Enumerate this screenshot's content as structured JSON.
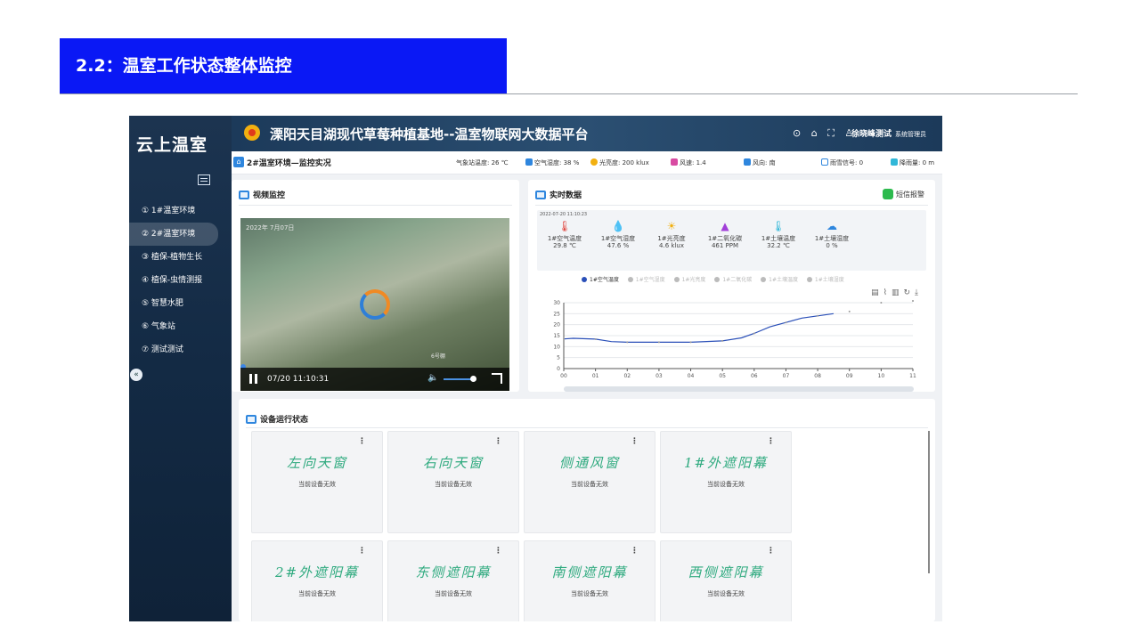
{
  "slide": {
    "title": "2.2：温室工作状态整体监控"
  },
  "app": {
    "logo": "云上温室",
    "header": {
      "title": "溧阳天目湖现代草莓种植基地--温室物联网大数据平台",
      "icons_text": "⊙ ⌂ ⛶ ♙",
      "user": "徐晓峰测试",
      "role": "系统管理员"
    },
    "nav": [
      {
        "label": "① 1#温室环境"
      },
      {
        "label": "② 2#温室环境"
      },
      {
        "label": "③ 植保-植物生长"
      },
      {
        "label": "④ 植保-虫情测报"
      },
      {
        "label": "⑤ 智慧水肥"
      },
      {
        "label": "⑥ 气象站"
      },
      {
        "label": "⑦ 测试测试"
      }
    ],
    "weather_bar": {
      "title": "2#温室环境—监控实况",
      "station": "气象站温度: 26 ℃",
      "air_humidity": "空气湿度: 38 %",
      "light": "光亮度: 200 klux",
      "wind_speed": "风速: 1.4",
      "wind_dir": "风向: 南",
      "rain_signal": "雨雪信号: 0",
      "rainfall": "降雨量: 0 m"
    },
    "video_panel": {
      "title": "视频监控",
      "timestamp": "2022年 7月07日",
      "camera": "6号棚",
      "time": "07/20 11:10:31"
    },
    "realtime_panel": {
      "title": "实时数据",
      "sms_label": "短信报警",
      "date": "2022-07-20 11:10:23",
      "sensors": [
        {
          "name": "1#空气温度",
          "value": "29.8 ℃",
          "icon": "thermometer-icon",
          "color": "#e0413a"
        },
        {
          "name": "1#空气湿度",
          "value": "47.6 %",
          "icon": "humidity-drop-icon",
          "color": "#2e86de"
        },
        {
          "name": "1#光亮度",
          "value": "4.6 klux",
          "icon": "sun-icon",
          "color": "#f2b010"
        },
        {
          "name": "1#二氧化碳",
          "value": "461 PPM",
          "icon": "co2-icon",
          "color": "#a13fd8"
        },
        {
          "name": "1#土壤温度",
          "value": "32.2 ℃",
          "icon": "soil-temp-icon",
          "color": "#31b7d8"
        },
        {
          "name": "1#土壤湿度",
          "value": "0 %",
          "icon": "soil-humidity-icon",
          "color": "#2e86de"
        }
      ],
      "legend": [
        "1#空气温度",
        "1#空气湿度",
        "1#光亮度",
        "1#二氧化碳",
        "1#土壤温度",
        "1#土壤湿度"
      ]
    },
    "device_panel": {
      "title": "设备运行状态",
      "devices": [
        {
          "name": "左向天窗",
          "status": "当前设备无效"
        },
        {
          "name": "右向天窗",
          "status": "当前设备无效"
        },
        {
          "name": "侧通风窗",
          "status": "当前设备无效"
        },
        {
          "name": "1#外遮阳幕",
          "status": "当前设备无效"
        },
        {
          "name": "2#外遮阳幕",
          "status": "当前设备无效"
        },
        {
          "name": "东侧遮阳幕",
          "status": "当前设备无效"
        },
        {
          "name": "南侧遮阳幕",
          "status": "当前设备无效"
        },
        {
          "name": "西侧遮阳幕",
          "status": "当前设备无效"
        }
      ]
    }
  },
  "chart_data": {
    "type": "line",
    "x": [
      "00",
      "01",
      "02",
      "03",
      "04",
      "05",
      "06",
      "07",
      "08",
      "09",
      "10",
      "11"
    ],
    "yticks": [
      "0",
      "5",
      "10",
      "15",
      "20",
      "25",
      "30"
    ],
    "ylim": [
      0,
      30
    ],
    "series": [
      {
        "name": "1#空气温度",
        "color": "#2a4fb8",
        "values": [
          [
            0,
            13.5
          ],
          [
            0.3,
            13.8
          ],
          [
            1,
            13.4
          ],
          [
            1.5,
            12.3
          ],
          [
            2,
            12
          ],
          [
            3,
            12
          ],
          [
            4,
            12
          ],
          [
            5,
            12.6
          ],
          [
            5.6,
            14
          ],
          [
            6,
            16
          ],
          [
            6.5,
            19
          ],
          [
            7,
            21
          ],
          [
            7.5,
            23
          ],
          [
            8,
            24
          ],
          [
            8.5,
            25
          ]
        ]
      },
      {
        "name": "points",
        "color": "#999",
        "values": [
          [
            9,
            26
          ],
          [
            10,
            30
          ],
          [
            11,
            33
          ]
        ]
      }
    ]
  }
}
